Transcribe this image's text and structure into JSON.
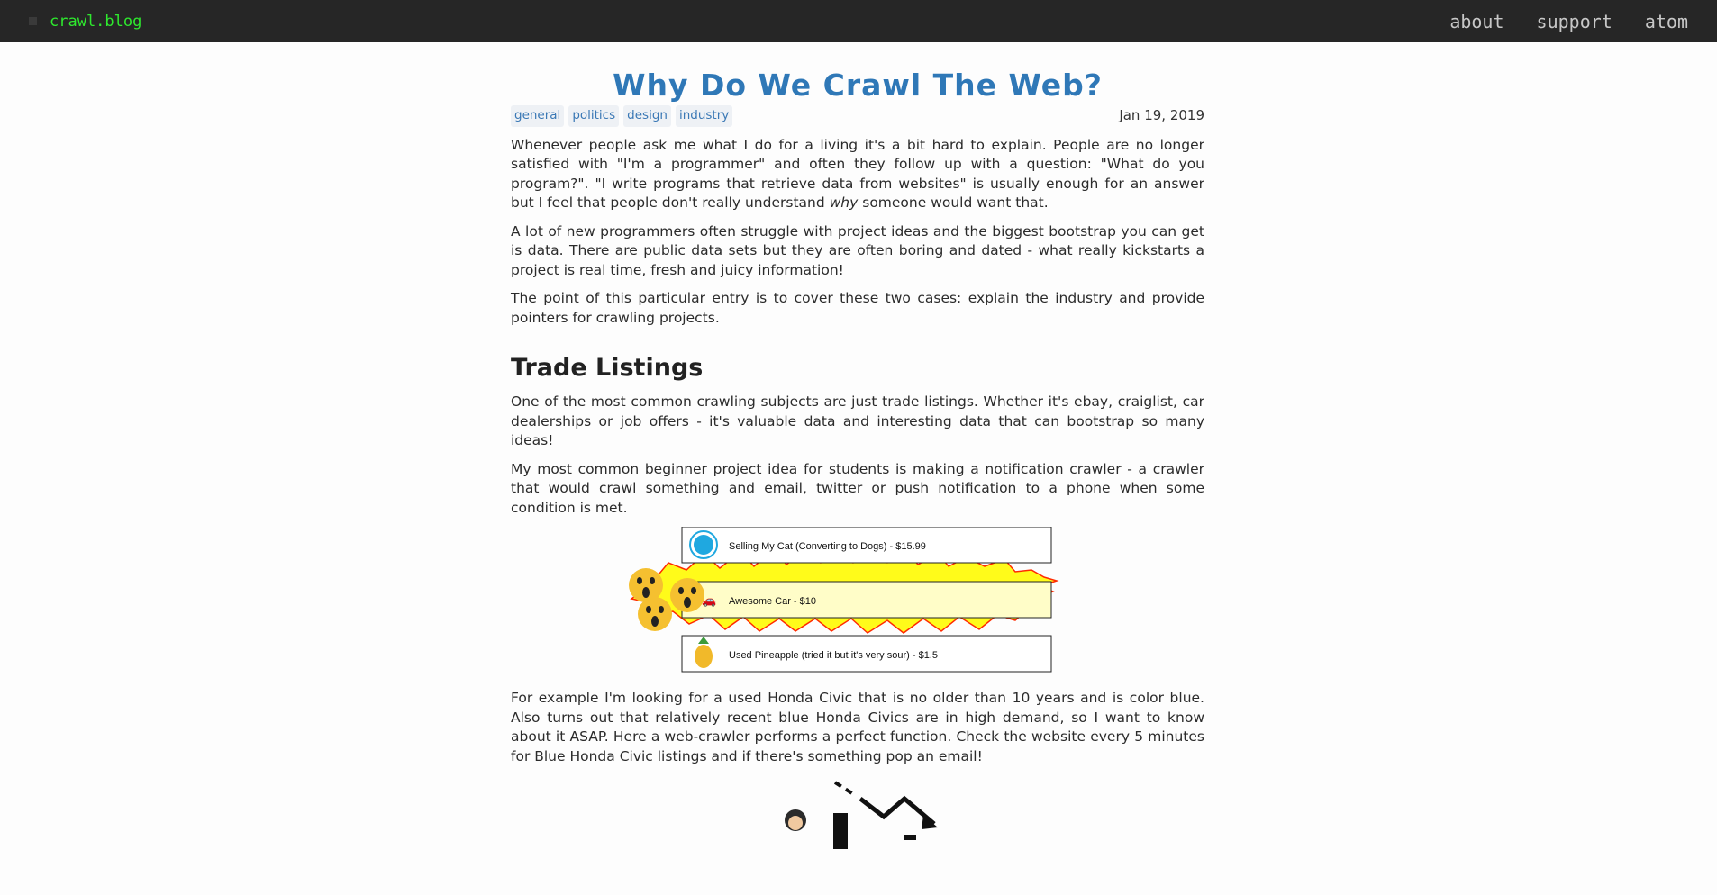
{
  "header": {
    "brand": "crawl.blog",
    "nav": [
      "about",
      "support",
      "atom"
    ]
  },
  "post": {
    "title": "Why Do We Crawl The Web?",
    "tags": [
      "general",
      "politics",
      "design",
      "industry"
    ],
    "date": "Jan 19, 2019",
    "intro_p1_a": "Whenever people ask me what I do for a living it's a bit hard to explain. People are no longer satisfied with \"I'm a programmer\" and often they follow up with a question: \"What do you program?\". \"I write programs that retrieve data from websites\" is usually enough for an answer but I feel that people don't really understand ",
    "intro_p1_em": "why",
    "intro_p1_b": " someone would want that.",
    "intro_p2": "A lot of new programmers often struggle with project ideas and the biggest bootstrap you can get is data. There are public data sets but they are often boring and dated - what really kickstarts a project is real time, fresh and juicy information!",
    "intro_p3": "The point of this particular entry is to cover these two cases: explain the industry and provide pointers for crawling projects.",
    "section1_title": "Trade Listings",
    "s1_p1": "One of the most common crawling subjects are just trade listings. Whether it's ebay, craiglist, car dealerships or job offers - it's valuable data and interesting data that can bootstrap so many ideas!",
    "s1_p2": "My most common beginner project idea for students is making a notification crawler - a crawler that would crawl something and email, twitter or push notification to a phone when some condition is met.",
    "s1_p3": "For example I'm looking for a used Honda Civic that is no older than 10 years and is color blue. Also turns out that relatively recent blue Honda Civics are in high demand, so I want to know about it ASAP. Here a web-crawler performs a perfect function. Check the website every 5 minutes for Blue Honda Civic listings and if there's something pop an email!"
  },
  "listings": [
    "Selling My Cat (Converting to Dogs) - $15.99",
    "Awesome Car - $10",
    "Used Pineapple (tried it but it's very sour) - $1.5"
  ],
  "colors": {
    "topbar": "#262626",
    "brand": "#2ee82e",
    "title": "#2f78b7",
    "tag_text": "#3a78b5",
    "tag_bg": "#eef1f5",
    "highlight_row": "#fffdc8",
    "burst_fill": "#fffb1a",
    "burst_stroke": "#ff2a00"
  }
}
